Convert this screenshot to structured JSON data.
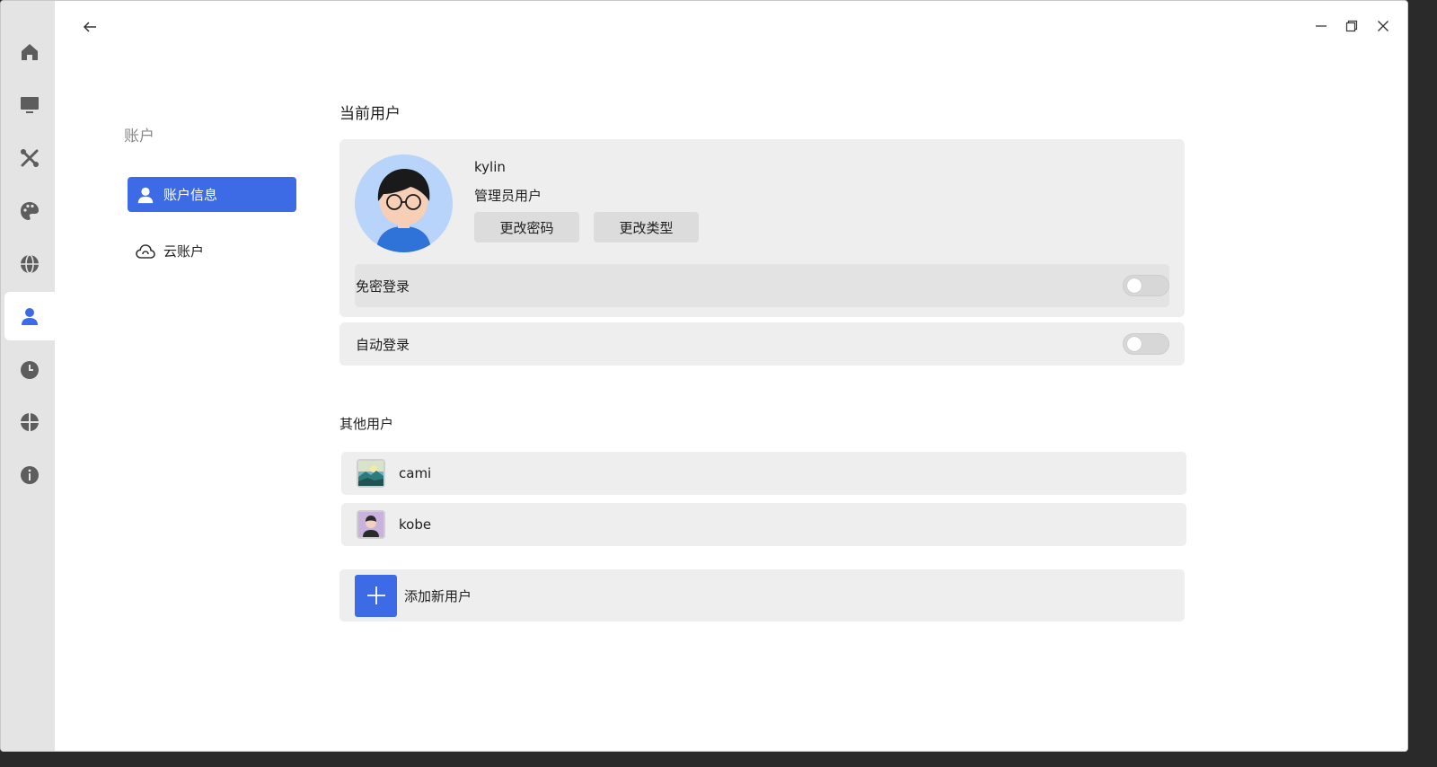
{
  "colors": {
    "accent": "#3d6be5",
    "rail_bg": "#e4e4e4",
    "card_bg": "#eeeeee"
  },
  "rail": {
    "items": [
      {
        "icon": "home-icon"
      },
      {
        "icon": "monitor-icon"
      },
      {
        "icon": "tools-icon"
      },
      {
        "icon": "palette-icon"
      },
      {
        "icon": "globe-icon"
      },
      {
        "icon": "user-icon",
        "active": true
      },
      {
        "icon": "clock-icon"
      },
      {
        "icon": "update-icon"
      },
      {
        "icon": "info-icon"
      }
    ]
  },
  "nav": {
    "title": "账户",
    "items": [
      {
        "label": "账户信息",
        "icon": "user-icon",
        "active": true
      },
      {
        "label": "云账户",
        "icon": "cloud-icon"
      }
    ]
  },
  "current_user": {
    "section_title": "当前用户",
    "username": "kylin",
    "type": "管理员用户",
    "change_password": "更改密码",
    "change_type": "更改类型",
    "passwordless_login": {
      "label": "免密登录",
      "enabled": false
    },
    "auto_login": {
      "label": "自动登录",
      "enabled": false
    }
  },
  "other_users": {
    "section_title": "其他用户",
    "users": [
      {
        "name": "cami",
        "avatar": "landscape-avatar"
      },
      {
        "name": "kobe",
        "avatar": "person-avatar"
      }
    ]
  },
  "add_user": {
    "label": "添加新用户"
  }
}
